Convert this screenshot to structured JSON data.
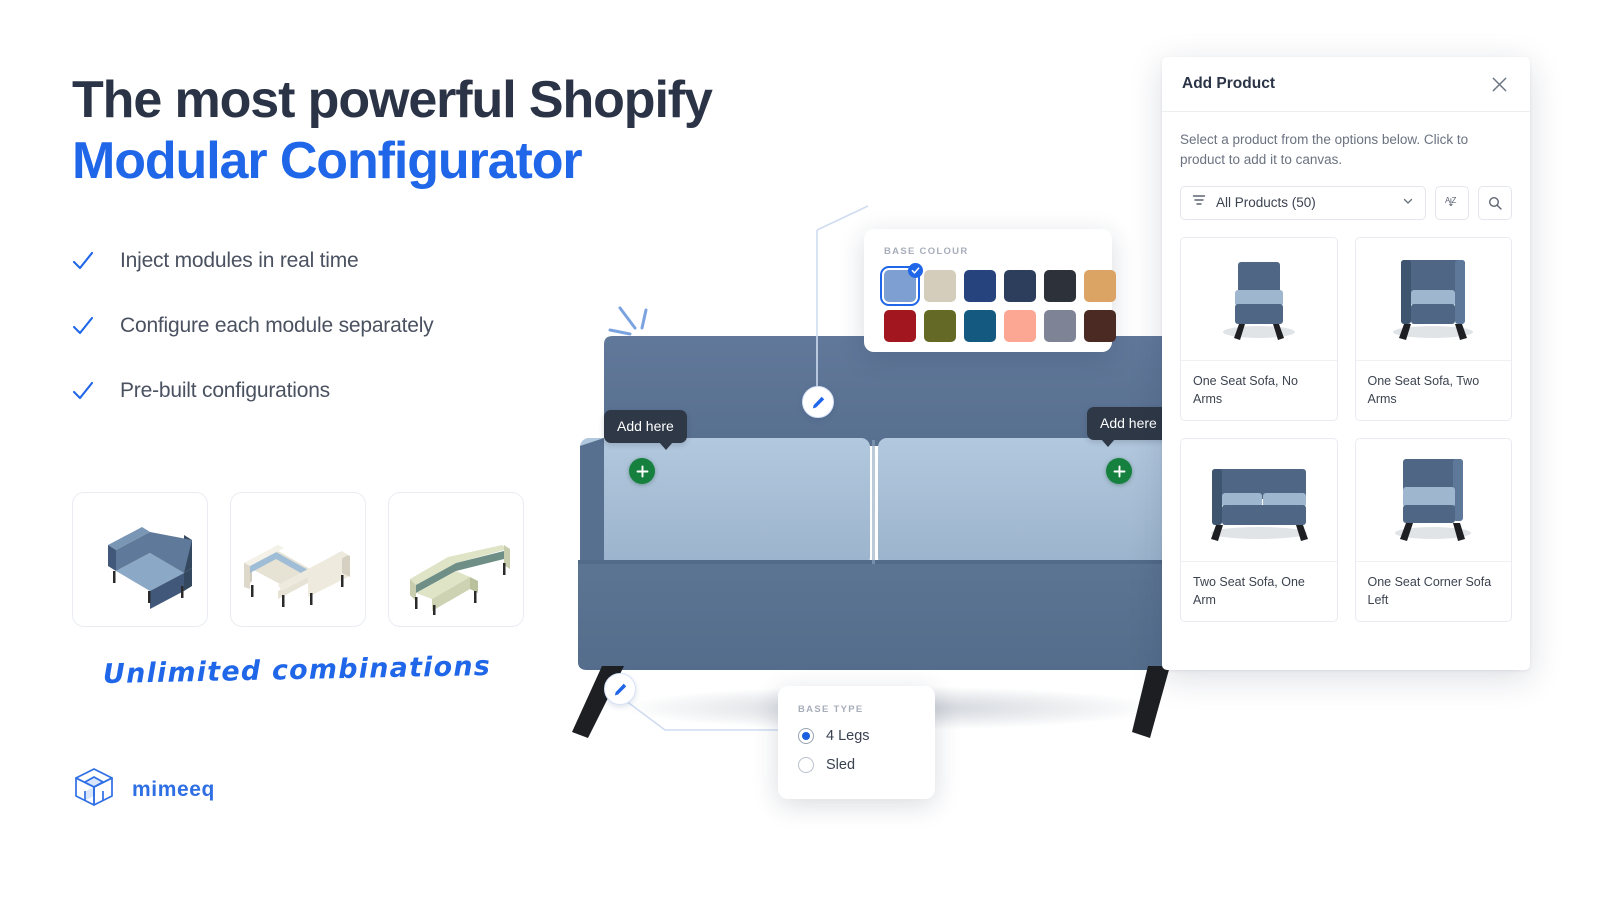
{
  "hero": {
    "line1": "The most powerful Shopify",
    "line2": "Modular Configurator"
  },
  "features": [
    {
      "label": "Inject modules in real time",
      "icon": "check-icon"
    },
    {
      "label": "Configure each module separately",
      "icon": "check-icon"
    },
    {
      "label": "Pre-built configurations",
      "icon": "check-icon"
    }
  ],
  "thumbnails": [
    {
      "name": "u-shape-blue-sofa-thumb"
    },
    {
      "name": "l-shape-cream-sofa-thumb"
    },
    {
      "name": "long-green-sofa-thumb"
    }
  ],
  "tagline": "Unlimited combinations",
  "brand": {
    "name": "mimeeq",
    "logo_icon": "mimeeq-cube-logo",
    "color": "#2f6fe4"
  },
  "canvas": {
    "add_here_left": "Add here",
    "add_here_right": "Add here",
    "plus_icon": "plus-icon",
    "edit_icon": "pencil-icon",
    "plus_color": "#16813f",
    "tooltip_color": "#2e3846"
  },
  "base_colour_popover": {
    "label": "BASE COLOUR",
    "selected_index": 0,
    "check_icon": "check-icon",
    "swatches": [
      {
        "name": "light-blue",
        "hex": "#7d9fd1"
      },
      {
        "name": "beige",
        "hex": "#d5cdbc"
      },
      {
        "name": "royal-blue",
        "hex": "#27437e"
      },
      {
        "name": "navy",
        "hex": "#2d3d5c"
      },
      {
        "name": "charcoal",
        "hex": "#2c313a"
      },
      {
        "name": "tan",
        "hex": "#dba364"
      },
      {
        "name": "crimson",
        "hex": "#a2161f"
      },
      {
        "name": "olive",
        "hex": "#646a25"
      },
      {
        "name": "teal-blue",
        "hex": "#145a80"
      },
      {
        "name": "salmon",
        "hex": "#fba793"
      },
      {
        "name": "slate-grey",
        "hex": "#7e8495"
      },
      {
        "name": "dark-brown",
        "hex": "#4a2a22"
      }
    ]
  },
  "base_type_popover": {
    "label": "BASE TYPE",
    "selected": "4 Legs",
    "options": [
      {
        "label": "4 Legs",
        "selected": true
      },
      {
        "label": "Sled",
        "selected": false
      }
    ]
  },
  "add_product_panel": {
    "title": "Add Product",
    "close_icon": "close-icon",
    "description": "Select a product from the options below. Click to product to add it to canvas.",
    "filter": {
      "icon": "filter-icon",
      "value": "All Products (50)",
      "chevron_icon": "chevron-down-icon"
    },
    "sort_button": {
      "icon": "sort-alpha-icon",
      "label": "AZ"
    },
    "search_button": {
      "icon": "search-icon"
    },
    "products": [
      {
        "name": "One Seat Sofa, No Arms",
        "thumb": "one-seat-no-arms-thumb"
      },
      {
        "name": "One Seat Sofa, Two Arms",
        "thumb": "one-seat-two-arms-thumb"
      },
      {
        "name": "Two Seat Sofa, One Arm",
        "thumb": "two-seat-one-arm-thumb"
      },
      {
        "name": "One Seat Corner Sofa Left",
        "thumb": "one-seat-corner-left-thumb"
      }
    ]
  },
  "colors": {
    "accent": "#1f66e8",
    "heading": "#2b3446",
    "body_text": "#4a5160",
    "sofa_frame": "#5e7899",
    "sofa_cushion": "#a9c0d8"
  }
}
